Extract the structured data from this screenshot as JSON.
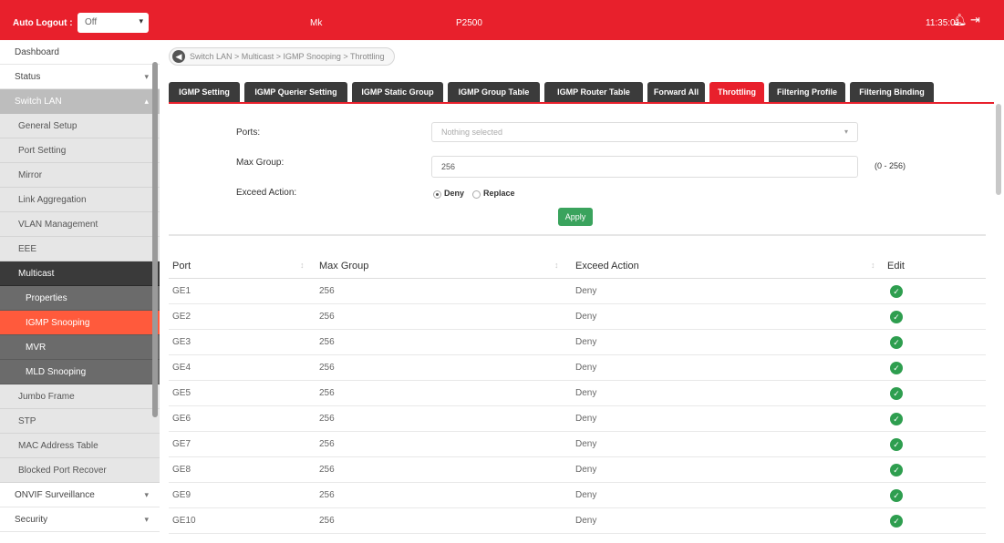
{
  "topbar": {
    "auto_logout_label": "Auto Logout :",
    "auto_logout_value": "Off",
    "mode": "Mk",
    "model": "P2500",
    "time": "11:35:01",
    "bell_icon": "bell-icon",
    "exit_icon": "logout-icon"
  },
  "sidebar": {
    "items": [
      {
        "label": "Dashboard"
      },
      {
        "label": "Status",
        "arrow": "▾"
      },
      {
        "label": "Switch LAN",
        "arrow": "▴"
      },
      {
        "label": "General Setup"
      },
      {
        "label": "Port Setting"
      },
      {
        "label": "Mirror"
      },
      {
        "label": "Link Aggregation"
      },
      {
        "label": "VLAN Management"
      },
      {
        "label": "EEE"
      },
      {
        "label": "Multicast"
      },
      {
        "label": "Properties"
      },
      {
        "label": "IGMP Snooping"
      },
      {
        "label": "MVR"
      },
      {
        "label": "MLD Snooping"
      },
      {
        "label": "Jumbo Frame"
      },
      {
        "label": "STP"
      },
      {
        "label": "MAC Address Table"
      },
      {
        "label": "Blocked Port Recover"
      },
      {
        "label": "ONVIF Surveillance",
        "arrow": "▾"
      },
      {
        "label": "Security",
        "arrow": "▾"
      }
    ]
  },
  "breadcrumb": {
    "text": "Switch LAN > Multicast > IGMP Snooping > Throttling"
  },
  "tabs": [
    {
      "label": "IGMP Setting"
    },
    {
      "label": "IGMP Querier Setting"
    },
    {
      "label": "IGMP Static Group"
    },
    {
      "label": "IGMP Group Table"
    },
    {
      "label": "IGMP Router Table"
    },
    {
      "label": "Forward All"
    },
    {
      "label": "Throttling"
    },
    {
      "label": "Filtering Profile"
    },
    {
      "label": "Filtering Binding"
    }
  ],
  "form": {
    "ports_label": "Ports:",
    "ports_placeholder": "Nothing selected",
    "max_group_label": "Max Group:",
    "max_group_value": "256",
    "max_group_range": "(0 - 256)",
    "exceed_action_label": "Exceed Action:",
    "option_deny": "Deny",
    "option_replace": "Replace",
    "selected_option": "Deny",
    "apply_label": "Apply"
  },
  "table": {
    "headers": [
      "Port",
      "Max Group",
      "Exceed Action",
      "Edit"
    ],
    "rows": [
      [
        "GE1",
        "256",
        "Deny"
      ],
      [
        "GE2",
        "256",
        "Deny"
      ],
      [
        "GE3",
        "256",
        "Deny"
      ],
      [
        "GE4",
        "256",
        "Deny"
      ],
      [
        "GE5",
        "256",
        "Deny"
      ],
      [
        "GE6",
        "256",
        "Deny"
      ],
      [
        "GE7",
        "256",
        "Deny"
      ],
      [
        "GE8",
        "256",
        "Deny"
      ],
      [
        "GE9",
        "256",
        "Deny"
      ],
      [
        "GE10",
        "256",
        "Deny"
      ]
    ]
  },
  "colors": {
    "brand_red": "#e8202c",
    "active_orange": "#ff5a3c",
    "apply_green": "#3aa35d",
    "edit_green": "#2e9e4f",
    "tab_dark": "#3b3b3b"
  }
}
